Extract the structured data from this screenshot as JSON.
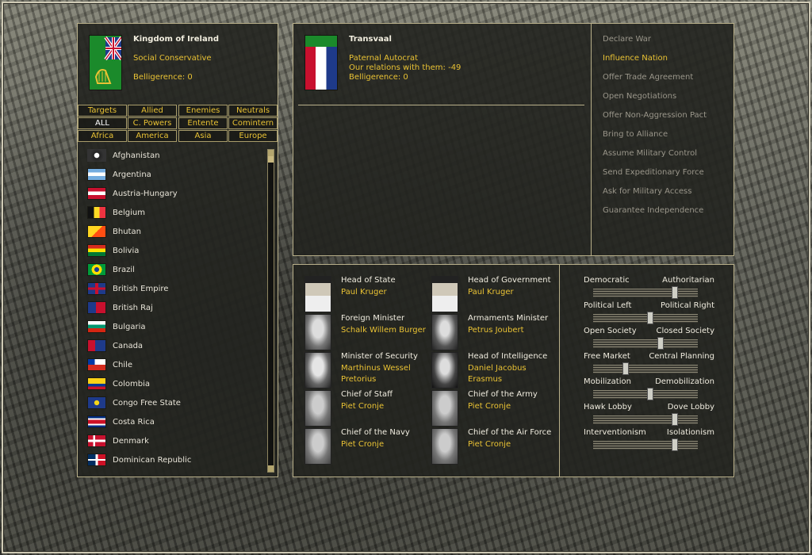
{
  "player": {
    "name": "Kingdom of Ireland",
    "ideology": "Social Conservative",
    "belligerence": "Belligerence: 0"
  },
  "filters": [
    [
      "Targets",
      "Allied",
      "Enemies",
      "Neutrals"
    ],
    [
      "ALL",
      "C. Powers",
      "Entente",
      "Comintern"
    ],
    [
      "Africa",
      "America",
      "Asia",
      "Europe"
    ]
  ],
  "countries": [
    "Afghanistan",
    "Argentina",
    "Austria-Hungary",
    "Belgium",
    "Bhutan",
    "Bolivia",
    "Brazil",
    "British Empire",
    "British Raj",
    "Bulgaria",
    "Canada",
    "Chile",
    "Colombia",
    "Congo Free State",
    "Costa Rica",
    "Denmark",
    "Dominican Republic"
  ],
  "target": {
    "name": "Transvaal",
    "ideology": "Paternal Autocrat",
    "relations": "Our relations with them: -49",
    "belligerence": "Belligerence: 0"
  },
  "actions": [
    {
      "label": "Declare War",
      "enabled": false
    },
    {
      "label": "Influence Nation",
      "enabled": true
    },
    {
      "label": "Offer Trade Agreement",
      "enabled": false
    },
    {
      "label": "Open Negotiations",
      "enabled": false
    },
    {
      "label": "Offer Non-Aggression Pact",
      "enabled": false
    },
    {
      "label": "Bring to Alliance",
      "enabled": false
    },
    {
      "label": "Assume Military Control",
      "enabled": false
    },
    {
      "label": "Send Expeditionary Force",
      "enabled": false
    },
    {
      "label": "Ask for Military Access",
      "enabled": false
    },
    {
      "label": "Guarantee Independence",
      "enabled": false
    }
  ],
  "cabinet": [
    {
      "role": "Head of State",
      "name": "Paul Kruger"
    },
    {
      "role": "Head of Government",
      "name": "Paul Kruger"
    },
    {
      "role": "Foreign Minister",
      "name": "Schalk Willem Burger"
    },
    {
      "role": "Armaments Minister",
      "name": "Petrus Joubert"
    },
    {
      "role": "Minister of Security",
      "name": "Marthinus Wessel Pretorius"
    },
    {
      "role": "Head of Intelligence",
      "name": "Daniel Jacobus Erasmus"
    },
    {
      "role": "Chief of Staff",
      "name": "Piet Cronje"
    },
    {
      "role": "Chief of the Army",
      "name": "Piet Cronje"
    },
    {
      "role": "Chief of the Navy",
      "name": "Piet Cronje"
    },
    {
      "role": "Chief of the Air Force",
      "name": "Piet Cronje"
    }
  ],
  "policies": [
    {
      "left": "Democratic",
      "right": "Authoritarian",
      "value": 0.8
    },
    {
      "left": "Political Left",
      "right": "Political Right",
      "value": 0.55
    },
    {
      "left": "Open Society",
      "right": "Closed Society",
      "value": 0.65
    },
    {
      "left": "Free Market",
      "right": "Central Planning",
      "value": 0.3
    },
    {
      "left": "Mobilization",
      "right": "Demobilization",
      "value": 0.55
    },
    {
      "left": "Hawk Lobby",
      "right": "Dove Lobby",
      "value": 0.8
    },
    {
      "left": "Interventionism",
      "right": "Isolationism",
      "value": 0.8
    }
  ],
  "colors": {
    "accent": "#e9c234",
    "border": "#b9b08a"
  }
}
